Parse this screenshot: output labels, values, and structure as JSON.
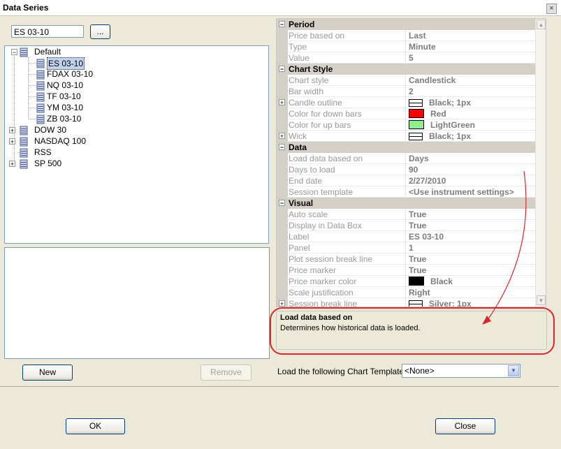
{
  "window": {
    "title": "Data Series"
  },
  "search": {
    "value": "ES 03-10",
    "browse_label": "..."
  },
  "tree": {
    "root": {
      "label": "Default",
      "children": [
        "ES 03-10",
        "FDAX 03-10",
        "NQ 03-10",
        "TF 03-10",
        "YM 03-10",
        "ZB 03-10"
      ]
    },
    "others": [
      {
        "label": "DOW 30",
        "expandable": true
      },
      {
        "label": "NASDAQ 100",
        "expandable": true
      },
      {
        "label": "RSS",
        "expandable": false
      },
      {
        "label": "SP 500",
        "expandable": true
      }
    ]
  },
  "properties": {
    "period": {
      "label": "Period",
      "rows": [
        {
          "name": "Price based on",
          "value": "Last"
        },
        {
          "name": "Type",
          "value": "Minute"
        },
        {
          "name": "Value",
          "value": "5"
        }
      ]
    },
    "chart_style": {
      "label": "Chart Style",
      "rows": [
        {
          "name": "Chart style",
          "value": "Candlestick"
        },
        {
          "name": "Bar width",
          "value": "2"
        },
        {
          "name": "Candle outline",
          "value": "Black; 1px"
        },
        {
          "name": "Color for down bars",
          "value": "Red"
        },
        {
          "name": "Color for up bars",
          "value": "LightGreen"
        },
        {
          "name": "Wick",
          "value": "Black; 1px"
        }
      ]
    },
    "data": {
      "label": "Data",
      "rows": [
        {
          "name": "Load data based on",
          "value": "Days"
        },
        {
          "name": "Days to load",
          "value": "90"
        },
        {
          "name": "End date",
          "value": "2/27/2010"
        },
        {
          "name": "Session template",
          "value": "<Use instrument settings>"
        }
      ]
    },
    "visual": {
      "label": "Visual",
      "rows": [
        {
          "name": "Auto scale",
          "value": "True"
        },
        {
          "name": "Display in Data Box",
          "value": "True"
        },
        {
          "name": "Label",
          "value": "ES 03-10"
        },
        {
          "name": "Panel",
          "value": "1"
        },
        {
          "name": "Plot session break line",
          "value": "True"
        },
        {
          "name": "Price marker",
          "value": "True"
        },
        {
          "name": "Price marker color",
          "value": "Black"
        },
        {
          "name": "Scale justification",
          "value": "Right"
        },
        {
          "name": "Session break line",
          "value": "Silver; 1px"
        }
      ]
    }
  },
  "colors": {
    "down_bars": "#ff0000",
    "up_bars": "#90ee90",
    "price_marker": "#000000",
    "highlight_oval": "#d9262b"
  },
  "description": {
    "title": "Load data based on",
    "text": "Determines how historical data is loaded."
  },
  "buttons": {
    "new": "New",
    "remove": "Remove",
    "ok": "OK",
    "close": "Close"
  },
  "template": {
    "label": "Load the following Chart Template:",
    "value": "<None>"
  },
  "icons": {
    "close": "×",
    "expand": "+",
    "collapse": "−",
    "dropdown": "▼",
    "scroll_up": "▲",
    "scroll_down": "▼"
  }
}
